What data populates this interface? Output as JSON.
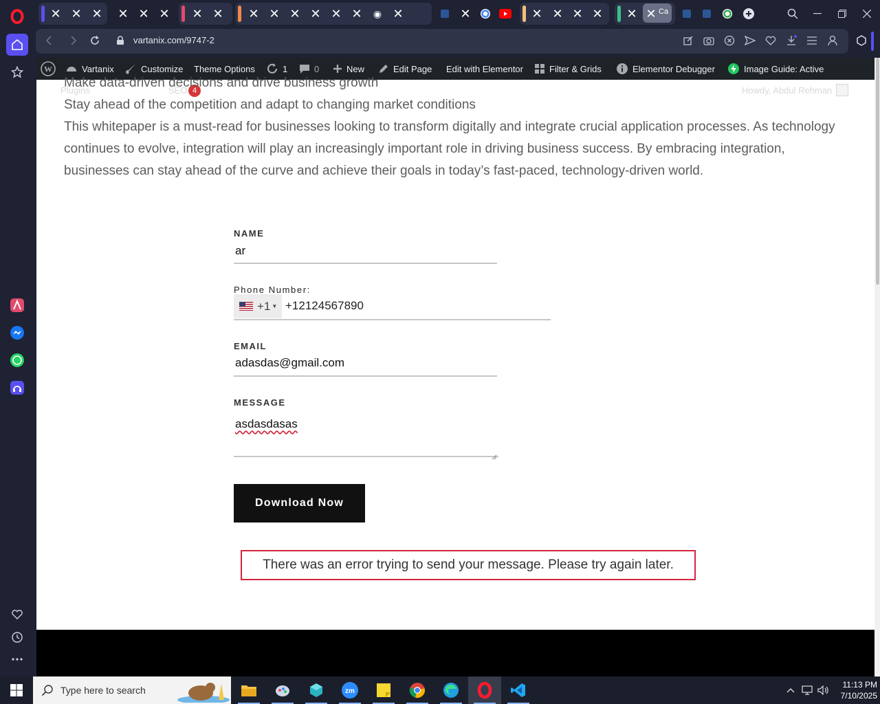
{
  "browser": {
    "url": "vartanix.com/9747-2",
    "active_tab_label": "Ca"
  },
  "admin_bar": {
    "site_name": "Vartanix",
    "customize": "Customize",
    "theme_options": "Theme Options",
    "updates_count": "1",
    "comments_count": "0",
    "new": "New",
    "edit_page": "Edit Page",
    "edit_elementor": "Edit with Elementor",
    "filter_grids": "Filter & Grids",
    "elementor_debugger": "Elementor Debugger",
    "image_guide": "Image Guide: Active"
  },
  "ghost": {
    "plugins": "Plugins",
    "seo": "SEO",
    "seo_badge": "4",
    "howdy": "Howdy, Abdul Rehman"
  },
  "content": {
    "bullet1": "Make data-driven decisions and drive business growth",
    "bullet2": "Stay ahead of the competition and adapt to changing market conditions",
    "paragraph": "This whitepaper is a must-read for businesses looking to transform digitally and integrate crucial application processes. As technology continues to evolve, integration will play an increasingly important role in driving business success. By embracing integration, businesses can stay ahead of the curve and achieve their goals in today’s fast-paced, technology-driven world."
  },
  "form": {
    "name_label": "NAME",
    "name_value": "ar",
    "phone_label": "Phone Number:",
    "phone_code": "+1",
    "phone_value": "+12124567890",
    "email_label": "EMAIL",
    "email_value": "adasdas@gmail.com",
    "message_label": "MESSAGE",
    "message_value": "asdasdasas",
    "submit_label": "Download Now",
    "error_message": "There was an error trying to send your message. Please try again later."
  },
  "taskbar": {
    "search_placeholder": "Type here to search",
    "time": "11:13 PM",
    "date": "7/10/2025"
  },
  "colors": {
    "opera_sidebar": "#1e2233",
    "accent": "#5a4ff0",
    "error_border": "#d2253a",
    "button_bg": "#111111"
  }
}
